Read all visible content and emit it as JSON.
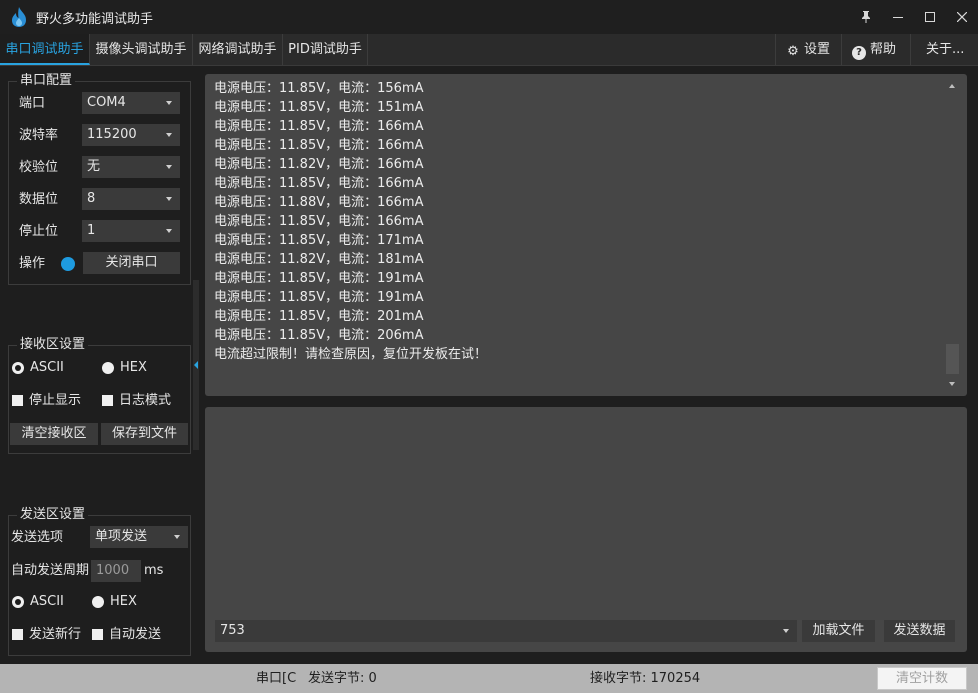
{
  "app": {
    "title": "野火多功能调试助手"
  },
  "window_buttons": {
    "pin": "📌",
    "minimize": "─",
    "maximize": "☐",
    "close": "✕"
  },
  "tabs": [
    {
      "label": "串口调试助手",
      "active": true
    },
    {
      "label": "摄像头调试助手",
      "active": false
    },
    {
      "label": "网络调试助手",
      "active": false
    },
    {
      "label": "PID调试助手",
      "active": false
    }
  ],
  "toolbar": {
    "settings": "设置",
    "help": "帮助",
    "about": "关于..."
  },
  "serial_config": {
    "title": "串口配置",
    "port_label": "端口",
    "port_value": "COM4",
    "baud_label": "波特率",
    "baud_value": "115200",
    "parity_label": "校验位",
    "parity_value": "无",
    "databits_label": "数据位",
    "databits_value": "8",
    "stopbits_label": "停止位",
    "stopbits_value": "1",
    "operation_label": "操作",
    "close_port_button": "关闭串口",
    "status_color": "#1e9be0"
  },
  "recv_settings": {
    "title": "接收区设置",
    "ascii": "ASCII",
    "hex": "HEX",
    "stop_display": "停止显示",
    "log_mode": "日志模式",
    "clear_button": "清空接收区",
    "save_button": "保存到文件"
  },
  "send_settings": {
    "title": "发送区设置",
    "option_label": "发送选项",
    "option_value": "单项发送",
    "period_label": "自动发送周期",
    "period_value": "1000",
    "period_unit": "ms",
    "ascii": "ASCII",
    "hex": "HEX",
    "newline": "发送新行",
    "auto_send": "自动发送"
  },
  "recv_lines": [
    "电源电压：11.85V，电流：156mA",
    "电源电压：11.85V，电流：151mA",
    "电源电压：11.85V，电流：166mA",
    "电源电压：11.85V，电流：166mA",
    "电源电压：11.82V，电流：166mA",
    "电源电压：11.85V，电流：166mA",
    "电源电压：11.88V，电流：166mA",
    "电源电压：11.85V，电流：166mA",
    "电源电压：11.85V，电流：171mA",
    "电源电压：11.82V，电流：181mA",
    "电源电压：11.85V，电流：191mA",
    "电源电压：11.85V，电流：191mA",
    "电源电压：11.85V，电流：201mA",
    "电源电压：11.85V，电流：206mA",
    "电流超过限制！请检查原因，复位开发板在试！"
  ],
  "send_area": {
    "input_value": "753",
    "load_file_button": "加载文件",
    "send_button": "发送数据"
  },
  "statusbar": {
    "port_status": "串口[C",
    "sent_bytes": "发送字节: 0",
    "recv_bytes": "接收字节: 170254",
    "clear_count_button": "清空计数"
  },
  "colors": {
    "accent": "#29a3e0",
    "panel": "#464646",
    "background": "#1e1e1e"
  }
}
